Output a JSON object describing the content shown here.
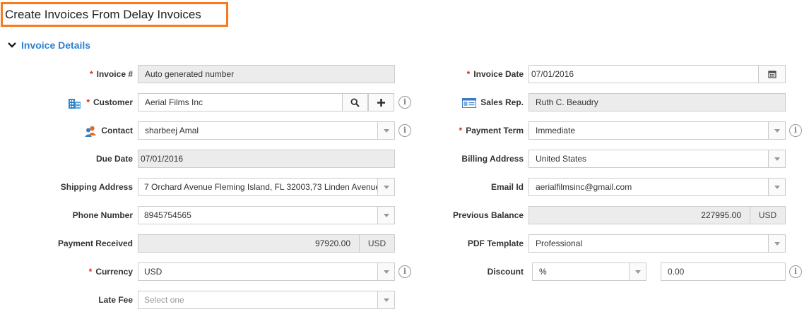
{
  "page": {
    "title": "Create Invoices From Delay Invoices"
  },
  "section": {
    "title": "Invoice Details"
  },
  "left": {
    "invoice_no": {
      "label": "Invoice #",
      "value": "Auto generated number"
    },
    "customer": {
      "label": "Customer",
      "value": "Aerial Films Inc"
    },
    "contact": {
      "label": "Contact",
      "value": "sharbeej Amal"
    },
    "due_date": {
      "label": "Due Date",
      "value": "07/01/2016"
    },
    "shipping_address": {
      "label": "Shipping Address",
      "value": "7 Orchard Avenue Fleming Island, FL 32003,73 Linden Avenue"
    },
    "phone_number": {
      "label": "Phone Number",
      "value": "8945754565"
    },
    "payment_received": {
      "label": "Payment Received",
      "value": "97920.00",
      "currency": "USD"
    },
    "currency": {
      "label": "Currency",
      "value": "USD"
    },
    "late_fee": {
      "label": "Late Fee",
      "placeholder": "Select one"
    }
  },
  "right": {
    "invoice_date": {
      "label": "Invoice Date",
      "value": "07/01/2016"
    },
    "sales_rep": {
      "label": "Sales Rep.",
      "value": "Ruth C. Beaudry"
    },
    "payment_term": {
      "label": "Payment Term",
      "value": "Immediate"
    },
    "billing_address": {
      "label": "Billing Address",
      "value": "United States"
    },
    "email_id": {
      "label": "Email Id",
      "value": "aerialfilmsinc@gmail.com"
    },
    "previous_balance": {
      "label": "Previous Balance",
      "value": "227995.00",
      "currency": "USD"
    },
    "pdf_template": {
      "label": "PDF Template",
      "value": "Professional"
    },
    "discount": {
      "label": "Discount",
      "type": "%",
      "value": "0.00"
    }
  },
  "required_mark": "*",
  "info_glyph": "i",
  "colors": {
    "accent": "#2e7fd1",
    "required": "#d9251d",
    "highlight": "#f47b20"
  }
}
